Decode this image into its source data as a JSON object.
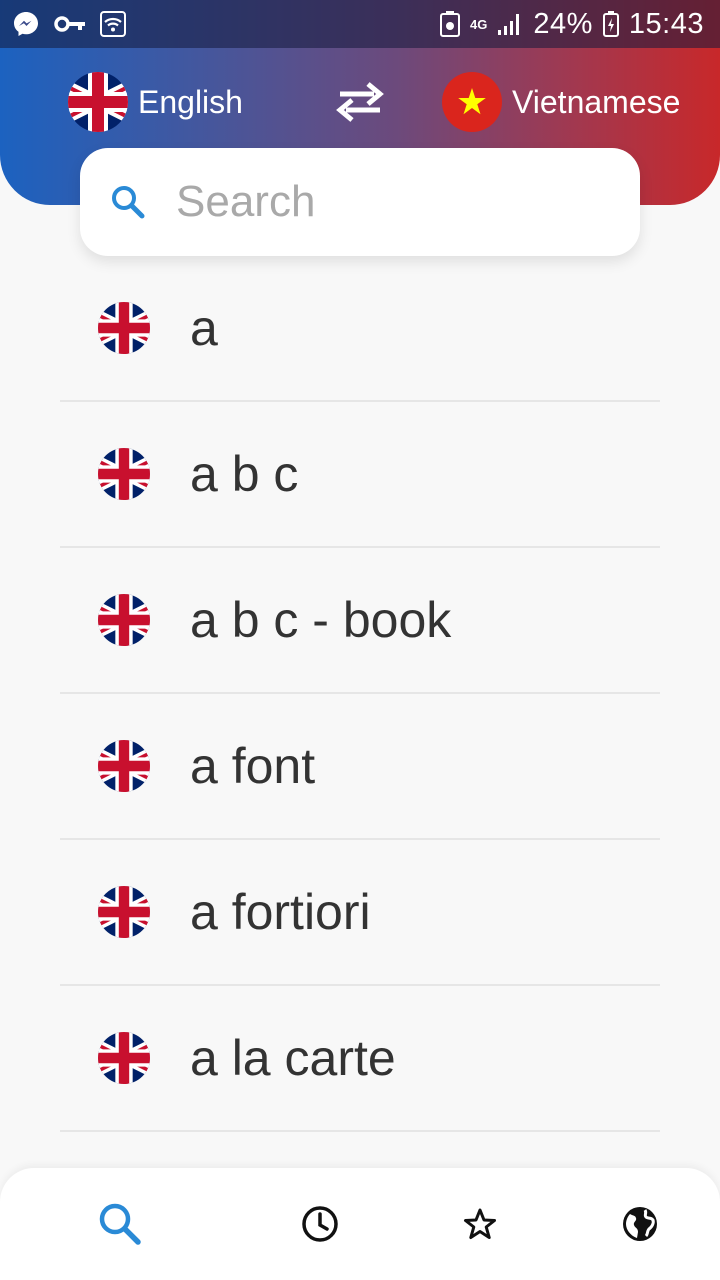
{
  "status_bar": {
    "battery_percent": "24%",
    "time": "15:43",
    "network": "4G",
    "left_icons": [
      "messenger-icon",
      "key-icon",
      "wifi-icon"
    ],
    "right_icons": [
      "storage-icon",
      "signal-icon",
      "battery-icon"
    ]
  },
  "header": {
    "source_language": {
      "label": "English",
      "flag": "uk-flag-icon"
    },
    "target_language": {
      "label": "Vietnamese",
      "flag": "vietnam-flag-icon"
    },
    "swap_icon": "swap-arrows-icon",
    "gradient_colors": [
      "#1c62c0",
      "#c8282a"
    ]
  },
  "search": {
    "placeholder": "Search",
    "value": ""
  },
  "results": [
    {
      "word": "a"
    },
    {
      "word": "a b c"
    },
    {
      "word": "a b c - book"
    },
    {
      "word": "a font"
    },
    {
      "word": "a fortiori"
    },
    {
      "word": "a la carte"
    }
  ],
  "bottom_nav": [
    {
      "name": "search",
      "icon": "search-icon",
      "active": true
    },
    {
      "name": "history",
      "icon": "clock-icon",
      "active": false
    },
    {
      "name": "favorites",
      "icon": "star-icon",
      "active": false
    },
    {
      "name": "languages",
      "icon": "globe-icon",
      "active": false
    }
  ],
  "colors": {
    "accent": "#2a8ad6",
    "text": "#333333",
    "divider": "#e6e6e6"
  }
}
